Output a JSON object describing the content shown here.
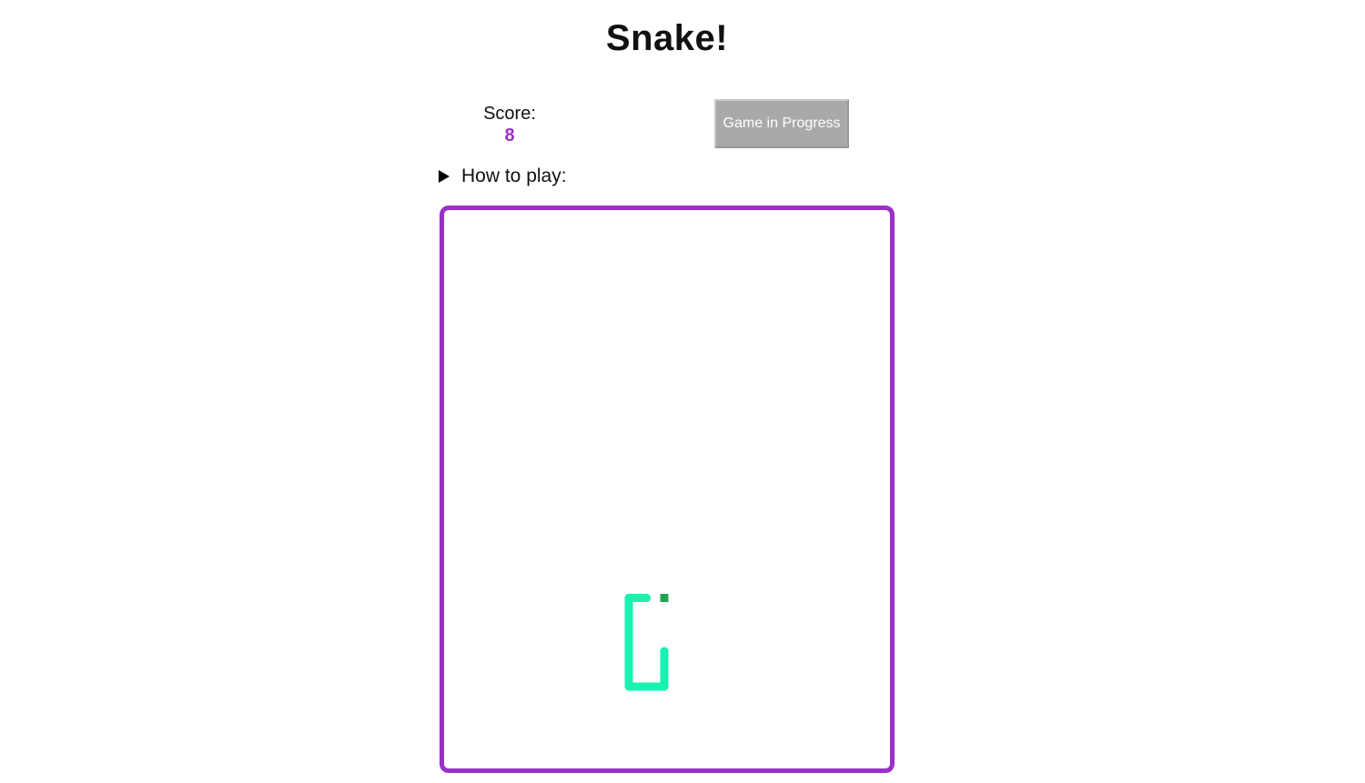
{
  "title": "Snake!",
  "score": {
    "label": "Score:",
    "value": "8"
  },
  "status_button": {
    "label": "Game in Progress"
  },
  "how_to_play": {
    "label": "How to play:",
    "expanded": false
  },
  "colors": {
    "accent": "#9b30c8",
    "snake": "#17f2b0",
    "food": "#1fa34f",
    "button_bg": "#a9a9a9",
    "button_text": "#ffffff"
  },
  "game": {
    "grid_cell_units": 1,
    "snake_segments": [
      {
        "col": 8,
        "row": 0
      },
      {
        "col": 8,
        "row": 1
      },
      {
        "col": 8,
        "row": 2
      },
      {
        "col": 7,
        "row": 2
      },
      {
        "col": 6,
        "row": 2
      },
      {
        "col": 6,
        "row": 1
      },
      {
        "col": 6,
        "row": 0
      },
      {
        "col": 6,
        "row": -1
      },
      {
        "col": 6,
        "row": -2
      },
      {
        "col": 6,
        "row": -3
      },
      {
        "col": 7,
        "row": -3
      }
    ],
    "food": {
      "col": 8,
      "row": -3
    }
  }
}
